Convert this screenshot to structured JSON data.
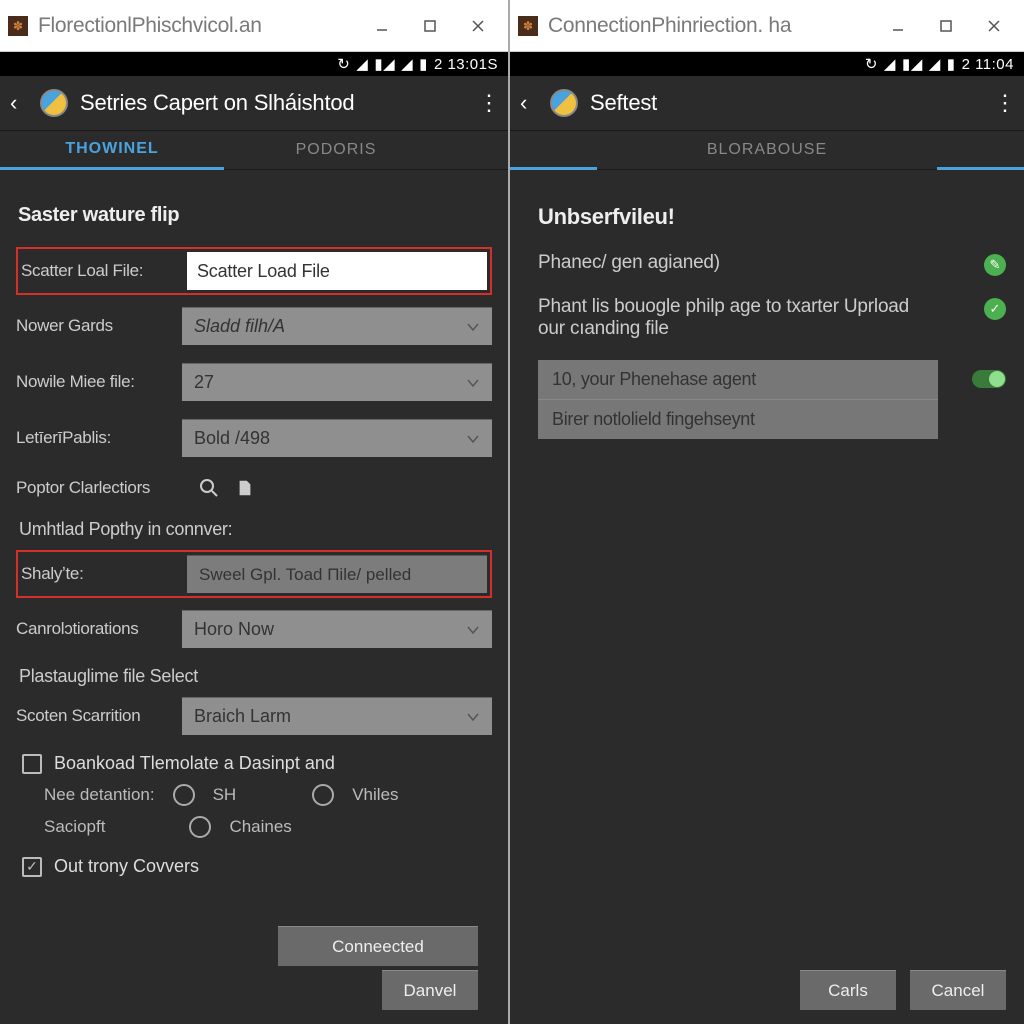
{
  "left": {
    "window_title": "FlorectionlPhischvicol.an",
    "status_time": "2 13:01S",
    "app_title": "Setries Capert on Slháishtod",
    "tabs": [
      "THOWINEL",
      "PODORIS"
    ],
    "section_heading": "Saster wature flip",
    "scatter_label": "Scatter Loal File:",
    "scatter_value": "Scatter Load File",
    "nower_label": "Nower Gards",
    "nower_value": "Sladd filh/A",
    "nowile_label": "Nowile Miee file:",
    "nowile_value": "27",
    "letier_label": "LetīerīPablis:",
    "letier_value": "Bold /498",
    "poptor_label": "Poptor Clarlectiors",
    "umhtlad_text": "Umhtlad Popthy in connver:",
    "shalyte_label": "Shalyʼte:",
    "shalyte_value": "Sweel Gpl. Toad Пile/ pelled",
    "canrol_label": "Canrolɔtiorations",
    "canrol_value": "Horo Now",
    "plasta_text": "Plastauglime file Select",
    "scoten_label": "Scoten Scarrition",
    "scoten_value": "Braich Larm",
    "boankoad_label": "Boankoad Tlemolate a Dasinpt and",
    "nee_label": "Nee detantion:",
    "radio_sh": "SH",
    "radio_vhiles": "Vhiles",
    "saciopft_label": "Saciopft",
    "radio_chaines": "Chaines",
    "out_trony": "Out trony Covvers",
    "btn_connected": "Conneected",
    "btn_danvel": "Danvel"
  },
  "right": {
    "window_title": "ConnectionPhinriection. ha",
    "status_time": "2 11:04",
    "app_title": "Seftest",
    "tab": "BLORABOUSE",
    "heading": "Unbserfvileu!",
    "line1": "Phaneс/ gen agianed)",
    "line2": "Phant lis bouogle philp age to txarter Uprload our cıanding file",
    "list_item1": "10, your Phenehase agent",
    "list_item2": "Birer notlolield fingehseynt",
    "btn_carls": "Carls",
    "btn_cancel": "Cancel"
  }
}
